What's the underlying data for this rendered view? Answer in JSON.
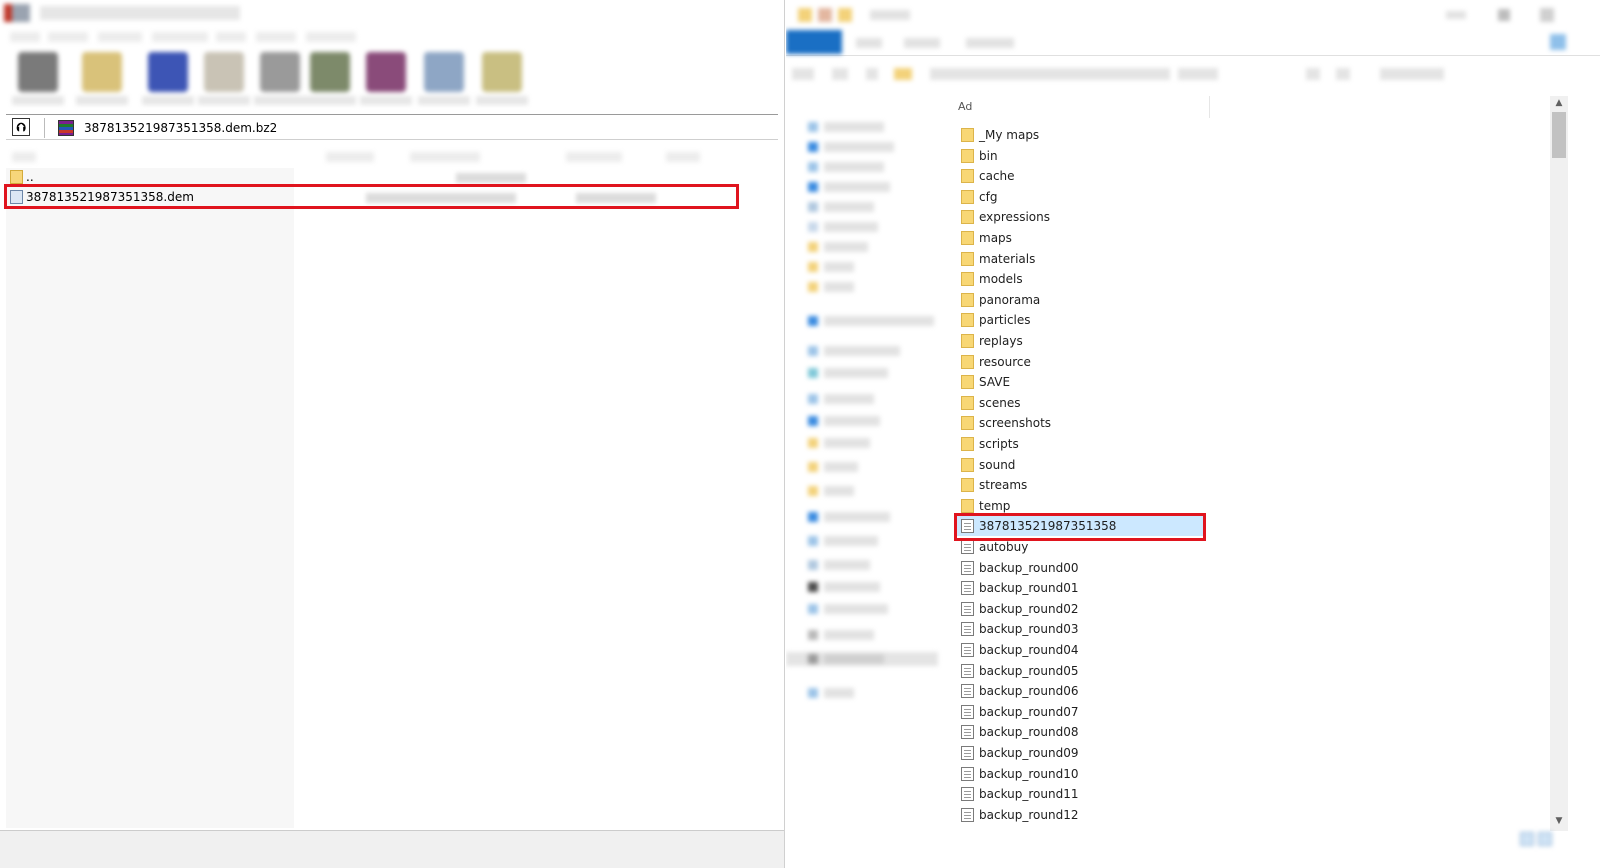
{
  "left_window": {
    "address_path": "387813521987351358.dem.bz2",
    "up_button_label": "⮉",
    "files": [
      {
        "name": "..",
        "type": "folder"
      },
      {
        "name": "387813521987351358.dem",
        "type": "file"
      }
    ]
  },
  "right_window": {
    "column_header": "Ad",
    "items": [
      {
        "name": "_My maps",
        "type": "folder"
      },
      {
        "name": "bin",
        "type": "folder"
      },
      {
        "name": "cache",
        "type": "folder"
      },
      {
        "name": "cfg",
        "type": "folder"
      },
      {
        "name": "expressions",
        "type": "folder"
      },
      {
        "name": "maps",
        "type": "folder"
      },
      {
        "name": "materials",
        "type": "folder"
      },
      {
        "name": "models",
        "type": "folder"
      },
      {
        "name": "panorama",
        "type": "folder"
      },
      {
        "name": "particles",
        "type": "folder"
      },
      {
        "name": "replays",
        "type": "folder"
      },
      {
        "name": "resource",
        "type": "folder"
      },
      {
        "name": "SAVE",
        "type": "folder"
      },
      {
        "name": "scenes",
        "type": "folder"
      },
      {
        "name": "screenshots",
        "type": "folder"
      },
      {
        "name": "scripts",
        "type": "folder"
      },
      {
        "name": "sound",
        "type": "folder"
      },
      {
        "name": "streams",
        "type": "folder"
      },
      {
        "name": "temp",
        "type": "folder"
      },
      {
        "name": "387813521987351358",
        "type": "file",
        "selected": true
      },
      {
        "name": "autobuy",
        "type": "file"
      },
      {
        "name": "backup_round00",
        "type": "file"
      },
      {
        "name": "backup_round01",
        "type": "file"
      },
      {
        "name": "backup_round02",
        "type": "file"
      },
      {
        "name": "backup_round03",
        "type": "file"
      },
      {
        "name": "backup_round04",
        "type": "file"
      },
      {
        "name": "backup_round05",
        "type": "file"
      },
      {
        "name": "backup_round06",
        "type": "file"
      },
      {
        "name": "backup_round07",
        "type": "file"
      },
      {
        "name": "backup_round08",
        "type": "file"
      },
      {
        "name": "backup_round09",
        "type": "file"
      },
      {
        "name": "backup_round10",
        "type": "file"
      },
      {
        "name": "backup_round11",
        "type": "file"
      },
      {
        "name": "backup_round12",
        "type": "file"
      }
    ],
    "scroll_up_glyph": "▲",
    "scroll_down_glyph": "▼"
  },
  "colors": {
    "highlight_border": "#e0141e",
    "selection_bg": "#cce8ff",
    "ribbon_accent": "#1a6fc4"
  }
}
